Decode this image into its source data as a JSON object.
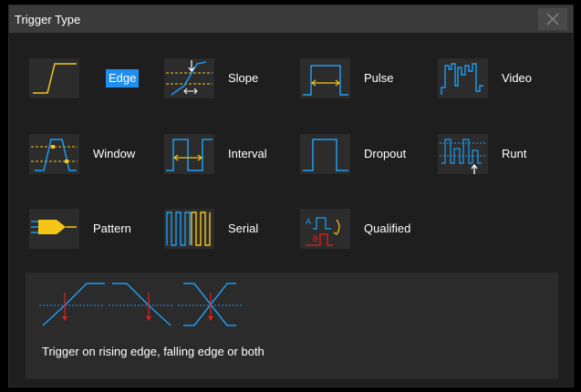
{
  "dialog": {
    "title": "Trigger Type",
    "close_icon": "close-icon"
  },
  "trigger_types": [
    {
      "label": "Edge",
      "icon": "edge-trigger-icon",
      "selected": true
    },
    {
      "label": "Slope",
      "icon": "slope-trigger-icon",
      "selected": false
    },
    {
      "label": "Pulse",
      "icon": "pulse-trigger-icon",
      "selected": false
    },
    {
      "label": "Video",
      "icon": "video-trigger-icon",
      "selected": false
    },
    {
      "label": "Window",
      "icon": "window-trigger-icon",
      "selected": false
    },
    {
      "label": "Interval",
      "icon": "interval-trigger-icon",
      "selected": false
    },
    {
      "label": "Dropout",
      "icon": "dropout-trigger-icon",
      "selected": false
    },
    {
      "label": "Runt",
      "icon": "runt-trigger-icon",
      "selected": false
    },
    {
      "label": "Pattern",
      "icon": "pattern-trigger-icon",
      "selected": false
    },
    {
      "label": "Serial",
      "icon": "serial-trigger-icon",
      "selected": false
    },
    {
      "label": "Qualified",
      "icon": "qualified-trigger-icon",
      "selected": false
    }
  ],
  "description": {
    "text": "Trigger on rising edge, falling edge or both",
    "illustration": "edge-slopes-illustration"
  },
  "colors": {
    "accent": "#1f8ff0",
    "waveform": "#f5c518",
    "level_line": "#1e9bf0",
    "marker": "#e02020"
  }
}
